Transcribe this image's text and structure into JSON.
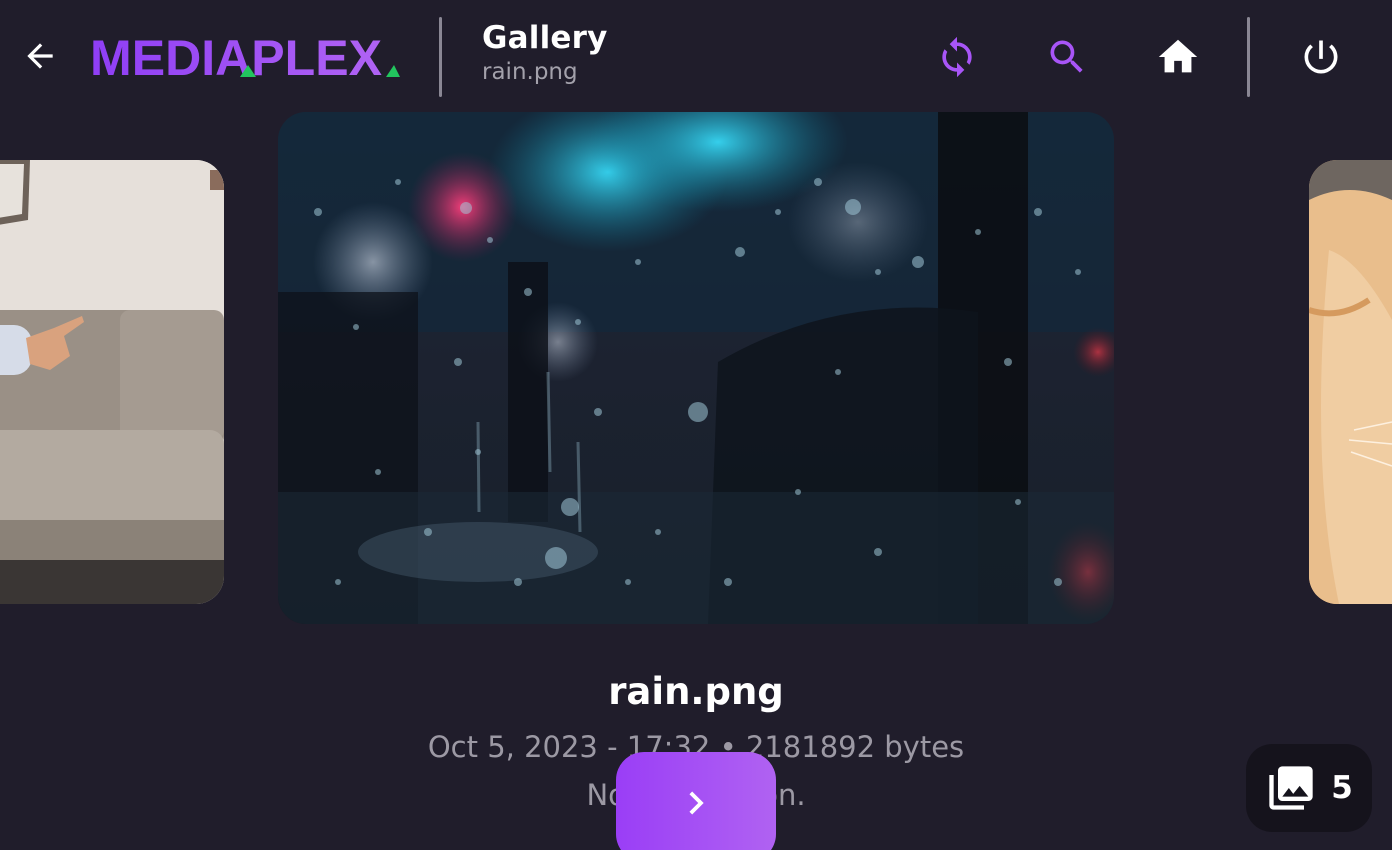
{
  "header": {
    "logo_text": "MEDIAPLEX",
    "title": "Gallery",
    "subtitle": "rain.png",
    "icons": {
      "back": "arrow-left-icon",
      "refresh": "refresh-icon",
      "search": "search-icon",
      "home": "home-icon",
      "power": "power-icon"
    }
  },
  "colors": {
    "background": "#201d2b",
    "accent": "#a855f7",
    "accent_secondary": "#22c55e",
    "badge_bg": "#15131c"
  },
  "viewer": {
    "current_file": "rain.png",
    "meta": "Oct 5, 2023 - 17:32 • 2181892 bytes",
    "description": "No description.",
    "item_count": "5"
  }
}
